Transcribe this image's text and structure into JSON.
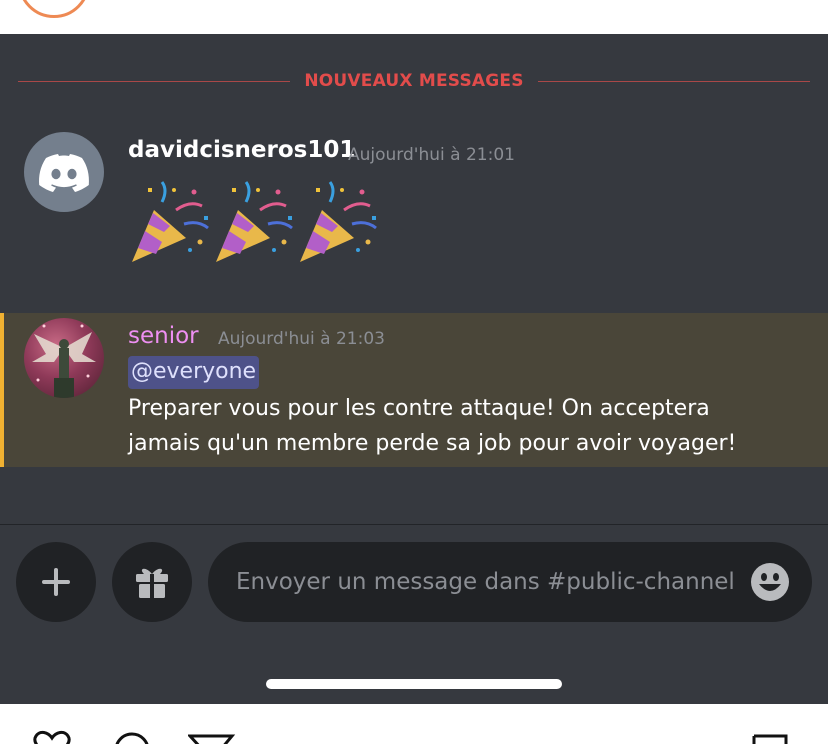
{
  "divider": {
    "label": "NOUVEAUX MESSAGES"
  },
  "messages": [
    {
      "author": "davidcisneros101",
      "timestamp": "Aujourd'hui à 21:01",
      "avatar_icon": "discord-logo-icon",
      "content": "🎉🎉🎉"
    },
    {
      "author": "senior",
      "timestamp": "Aujourd'hui à 21:03",
      "mention": "@everyone",
      "lines": [
        "Preparer vous pour les contre attaque! On acceptera",
        "jamais qu'un membre perde sa job pour avoir voyager!"
      ]
    }
  ],
  "composer": {
    "placeholder": "Envoyer un message dans #public-channel",
    "add_icon": "plus-icon",
    "gift_icon": "gift-icon",
    "emoji_icon": "smiley-icon"
  },
  "colors": {
    "background": "#36393f",
    "new_messages": "#e24c4b",
    "senior_name": "#ee8ff2",
    "mention_bg": "#4e5289",
    "highlight_bar": "#f0b132"
  }
}
